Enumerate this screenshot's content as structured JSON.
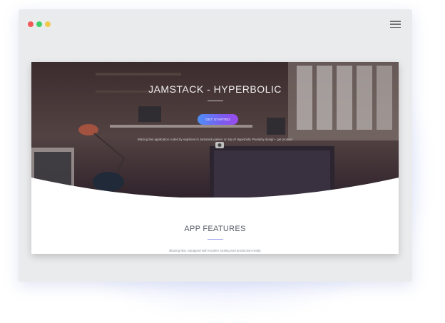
{
  "window": {
    "controls": [
      "close",
      "minimize",
      "maximize"
    ],
    "menu_icon": "hamburger-menu-icon"
  },
  "hero": {
    "title": "JAMSTACK - HYPERBOLIC",
    "cta_label": "GET STARTED",
    "tagline": "Blazing fast application coded by AppSeed in Jamstack pattern on top of Hyperbolic Pixelarity design - get product",
    "cta_gradient": [
      "#4f8ff7",
      "#9b4bea"
    ]
  },
  "features": {
    "title": "APP FEATURES",
    "description": "Blazing fast, equipped with modern tooling and production-ready"
  },
  "colors": {
    "dot_red": "#f25a5a",
    "dot_green": "#3fcf6a",
    "dot_yellow": "#f2c94c",
    "accent": "#8a92e8"
  }
}
